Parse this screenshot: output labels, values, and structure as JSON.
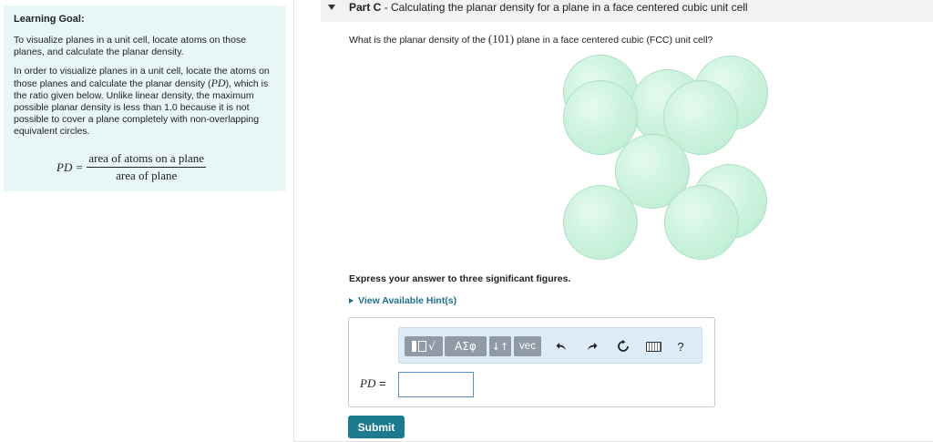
{
  "learning_goal": {
    "title": "Learning Goal:",
    "paragraph1": "To visualize planes in a unit cell, locate atoms on those planes, and calculate the planar density.",
    "paragraph2_a": "In order to visualize planes in a unit cell, locate the atoms on those planes and calculate the planar density (",
    "paragraph2_var": "PD",
    "paragraph2_b": "), which is the ratio given below. Unlike linear density, the maximum possible planar density is less than 1.0 because it is not possible to cover a plane completely with non-overlapping equivalent circles.",
    "formula": {
      "lhs": "PD =",
      "numerator": "area of atoms on a plane",
      "denominator": "area of plane"
    }
  },
  "part": {
    "label": "Part C",
    "separator": " - ",
    "title": "Calculating the planar density for a plane in a face centered cubic unit cell"
  },
  "question": {
    "text_before": "What is the planar density of the ",
    "plane_index": "(101)",
    "text_after": " plane in a face centered cubic (FCC) unit cell?"
  },
  "figure": {
    "description_icon": "fcc-atom-spheres",
    "atom_color": "#c8f0dc"
  },
  "instruction": "Express your answer to three significant figures.",
  "hint_link": "View Available Hint(s)",
  "toolbar": {
    "greek_label": "ΑΣφ",
    "sort_label": "↓↑",
    "vec_label": "vec",
    "help_label": "?"
  },
  "answer": {
    "label_var": "PD",
    "label_eq": " =",
    "value": ""
  },
  "submit_label": "Submit",
  "colors": {
    "goal_bg": "#e8f6f6",
    "toolbar_bg": "#dcebf7",
    "button_gray": "#8f9aa6",
    "submit": "#1c7a8f",
    "link": "#1f6f8b"
  }
}
